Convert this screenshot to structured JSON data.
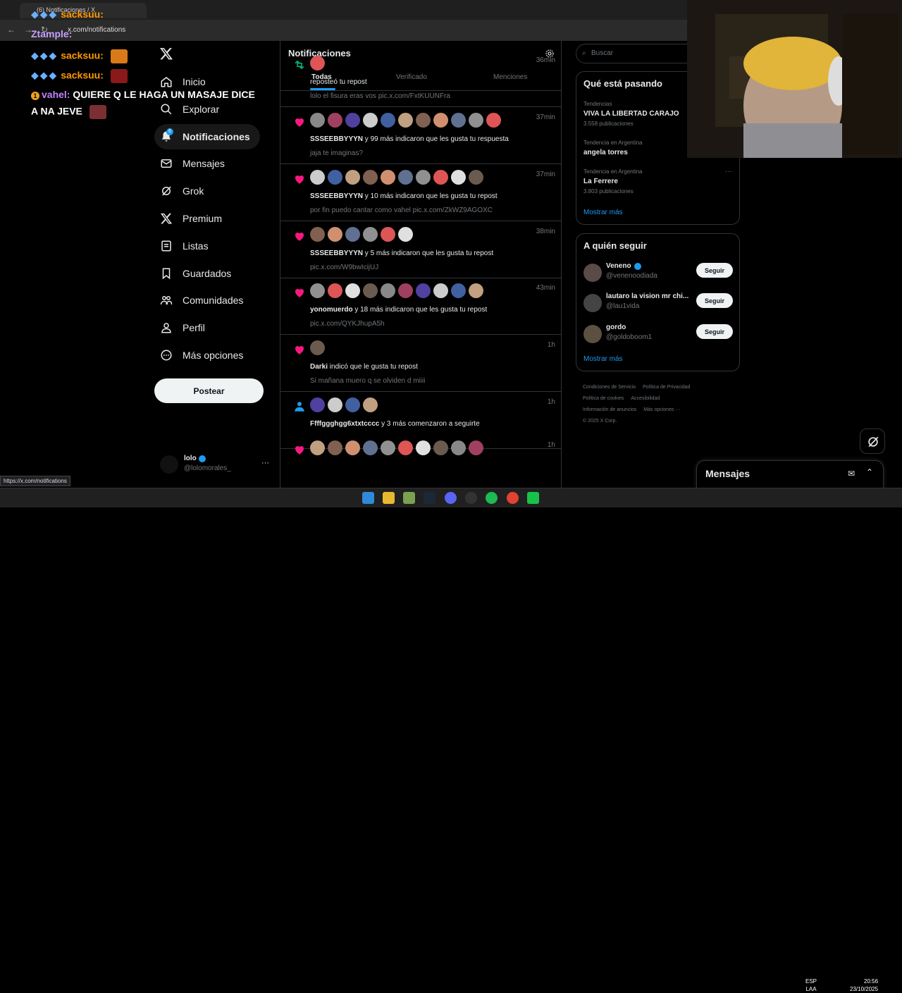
{
  "browser": {
    "tab_title": "(6) Notificaciones / X",
    "url": "x.com/notifications",
    "status_url": "https://x.com/notifications"
  },
  "stream_chat": [
    {
      "user": "sacksuu:",
      "message": ""
    },
    {
      "user": "Ztample:",
      "message": ""
    },
    {
      "user": "sacksuu:",
      "message": ""
    },
    {
      "user": "sacksuu:",
      "message": ""
    },
    {
      "user": "vahel:",
      "message": "QUIERE Q LE HAGA UN MASAJE DICE",
      "message2": "A NA JEVE"
    }
  ],
  "nav": {
    "logo": "X",
    "items": [
      {
        "label": "Inicio",
        "icon": "home-icon"
      },
      {
        "label": "Explorar",
        "icon": "search-icon"
      },
      {
        "label": "Notificaciones",
        "icon": "bell-icon",
        "badge": "6"
      },
      {
        "label": "Mensajes",
        "icon": "mail-icon"
      },
      {
        "label": "Grok",
        "icon": "grok-icon"
      },
      {
        "label": "Premium",
        "icon": "x-icon"
      },
      {
        "label": "Listas",
        "icon": "list-icon"
      },
      {
        "label": "Guardados",
        "icon": "bookmark-icon"
      },
      {
        "label": "Comunidades",
        "icon": "communities-icon"
      },
      {
        "label": "Perfil",
        "icon": "person-icon"
      },
      {
        "label": "Más opciones",
        "icon": "more-circle-icon"
      }
    ],
    "post_label": "Postear",
    "account": {
      "name": "lolo",
      "handle": "@lolomorales_",
      "more": "···"
    }
  },
  "main": {
    "title": "Notificaciones",
    "tabs": [
      "Todas",
      "Verificado",
      "Menciones"
    ],
    "notifications": [
      {
        "kind": "repost",
        "time": "36min",
        "bold": "",
        "text": "reposteó tu repost",
        "sub": "lolo el fisura eras vos pic.x.com/FxtKUUNFra",
        "avatars": 1
      },
      {
        "kind": "like",
        "time": "37min",
        "bold": "SSSEEBBYYYN",
        "text": " y 99 más indicaron que les gusta tu respuesta",
        "sub": "jaja te imaginas?",
        "avatars": 11
      },
      {
        "kind": "like",
        "time": "37min",
        "bold": "SSSEEBBYYYN",
        "text": " y 10 más indicaron que les gusta tu repost",
        "sub": "por fin puedo cantar como vahel pic.x.com/ZkWZ9AGOXC",
        "avatars": 10
      },
      {
        "kind": "like",
        "time": "38min",
        "bold": "SSSEEBBYYYN",
        "text": " y 5 más indicaron que les gusta tu repost",
        "sub": "pic.x.com/W9bwIcijUJ",
        "avatars": 6
      },
      {
        "kind": "like",
        "time": "43min",
        "bold": "yonomuerdo",
        "text": " y 18 más indicaron que les gusta tu repost",
        "sub": "pic.x.com/QYKJhupA5h",
        "avatars": 10
      },
      {
        "kind": "like",
        "time": "1h",
        "bold": "Darki",
        "text": " indicó que le gusta tu repost",
        "sub": "Si mañana muero q se olviden d miiii",
        "avatars": 1
      },
      {
        "kind": "follow",
        "time": "1h",
        "bold": "Ffffggghgg6xtxtcccc",
        "text": " y 3 más comenzaron a seguirte",
        "sub": "",
        "avatars": 4
      },
      {
        "kind": "like",
        "time": "1h",
        "bold": "",
        "text": "",
        "sub": "",
        "avatars": 10
      }
    ]
  },
  "right": {
    "search_placeholder": "Buscar",
    "trends_title": "Qué está pasando",
    "trends": [
      {
        "category": "Tendencias",
        "name": "VIVA LA LIBERTAD CARAJO",
        "count": "3.558 publicaciones"
      },
      {
        "category": "Tendencia en Argentina",
        "name": "angela torres",
        "count": ""
      },
      {
        "category": "Tendencia en Argentina",
        "name": "La Ferrere",
        "count": "3.803 publicaciones"
      }
    ],
    "show_more": "Mostrar más",
    "follow_title": "A quién seguir",
    "follow": [
      {
        "name": "Veneno",
        "handle": "@venenoodiada",
        "verified": true,
        "button": "Seguir"
      },
      {
        "name": "lautaro la vision mr chi...",
        "handle": "@lau1vida",
        "verified": false,
        "button": "Seguir"
      },
      {
        "name": "gordo",
        "handle": "@goldoboom1",
        "verified": false,
        "button": "Seguir"
      }
    ],
    "footer": [
      "Condiciones de Servicio",
      "Política de Privacidad",
      "Política de cookies",
      "Accesibilidad",
      "Información de anuncios",
      "Más opciones ···",
      "© 2025 X Corp."
    ],
    "messages_title": "Mensajes"
  },
  "taskbar": {
    "lang1": "ESP",
    "lang2": "LAA",
    "time": "20:56",
    "date": "23/10/2025"
  },
  "colors": {
    "accent": "#1d9bf0",
    "like": "#f91880",
    "repost": "#00ba7c",
    "bg": "#000000",
    "border": "#2f3336"
  }
}
